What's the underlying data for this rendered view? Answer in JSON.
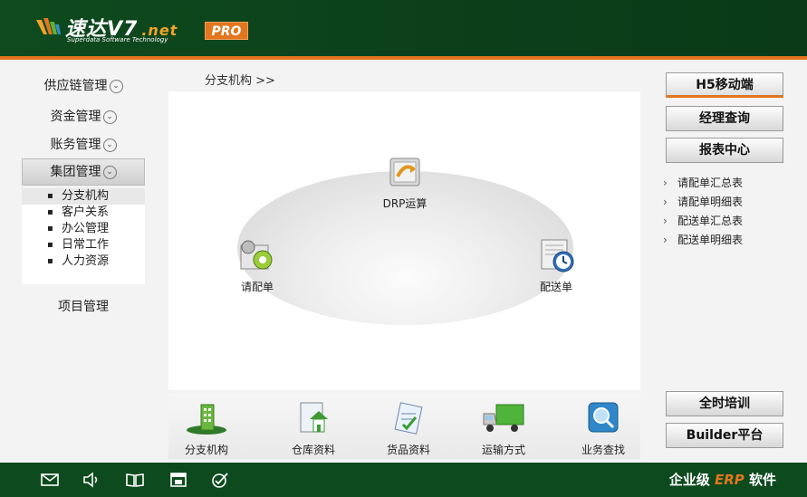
{
  "header": {
    "logo_text": "速达V7",
    "logo_net": ".net",
    "logo_subtitle": "Superdata Software Technology",
    "pro_badge": "PRO"
  },
  "nav": {
    "items": [
      {
        "label": "供应链管理"
      },
      {
        "label": "资金管理"
      },
      {
        "label": "账务管理"
      },
      {
        "label": "集团管理"
      },
      {
        "label": "项目管理"
      }
    ],
    "submenu": [
      {
        "label": "分支机构"
      },
      {
        "label": "客户关系"
      },
      {
        "label": "办公管理"
      },
      {
        "label": "日常工作"
      },
      {
        "label": "人力资源"
      }
    ]
  },
  "breadcrumb": "分支机构  >>",
  "flow": {
    "drp": "DRP运算",
    "request": "请配单",
    "delivery": "配送单"
  },
  "dock": [
    {
      "label": "分支机构",
      "icon": "building-icon"
    },
    {
      "label": "仓库资料",
      "icon": "warehouse-icon"
    },
    {
      "label": "货品资料",
      "icon": "clipboard-icon"
    },
    {
      "label": "运输方式",
      "icon": "truck-icon"
    },
    {
      "label": "业务查找",
      "icon": "magnifier-icon"
    }
  ],
  "right": {
    "h5": "H5移动端",
    "manager": "经理查询",
    "reports": "报表中心",
    "links": [
      {
        "label": "请配单汇总表"
      },
      {
        "label": "请配单明细表"
      },
      {
        "label": "配送单汇总表"
      },
      {
        "label": "配送单明细表"
      }
    ],
    "training": "全时培训",
    "builder": "Builder平台"
  },
  "footer": {
    "brand_prefix": "企业级",
    "brand_erp": "ERP",
    "brand_suffix": "软件",
    "icons": [
      "mail-icon",
      "speaker-icon",
      "book-icon",
      "window-icon",
      "check-circle-icon"
    ]
  },
  "colors": {
    "header_green": "#0b3f1a",
    "accent_orange": "#e2761e"
  }
}
